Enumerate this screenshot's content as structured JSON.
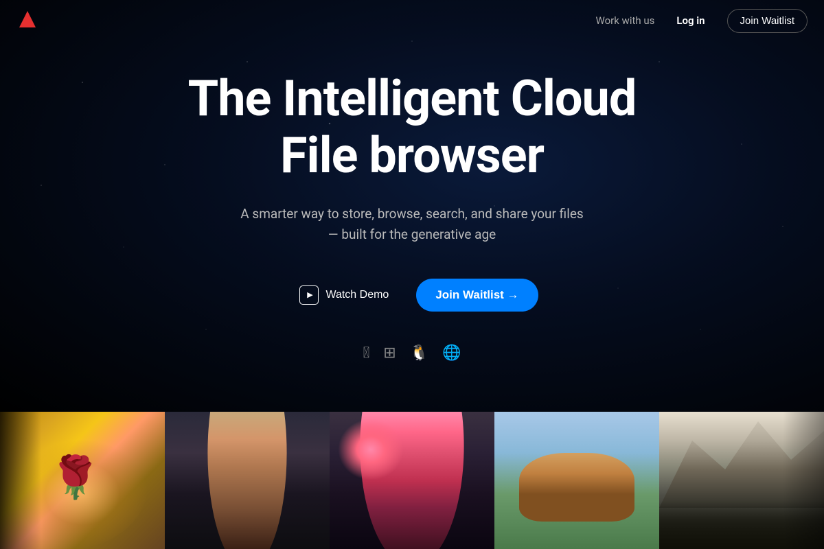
{
  "brand": {
    "logo_color": "#e63030"
  },
  "navbar": {
    "work_with_us": "Work with us",
    "login": "Log in",
    "join_waitlist": "Join Waitlist"
  },
  "hero": {
    "title_line1": "The Intelligent Cloud",
    "title_line2": "File browser",
    "subtitle_line1": "A smarter way to store, browse, search, and share your files",
    "subtitle_line2": "— built for the generative age",
    "watch_demo": "Watch Demo",
    "join_waitlist": "Join Waitlist →"
  },
  "platforms": [
    {
      "name": "apple",
      "icon": ""
    },
    {
      "name": "windows",
      "icon": "⊞"
    },
    {
      "name": "linux",
      "icon": ""
    },
    {
      "name": "web",
      "icon": "⊕"
    }
  ],
  "images": [
    {
      "alt": "roses",
      "class": "img-roses"
    },
    {
      "alt": "woman-dark-hair",
      "class": "img-woman-dark"
    },
    {
      "alt": "woman-pink-hair",
      "class": "img-woman-pink"
    },
    {
      "alt": "corgi-toy-car",
      "class": "img-corgi"
    },
    {
      "alt": "mountain-scene",
      "class": "img-mountain"
    }
  ]
}
